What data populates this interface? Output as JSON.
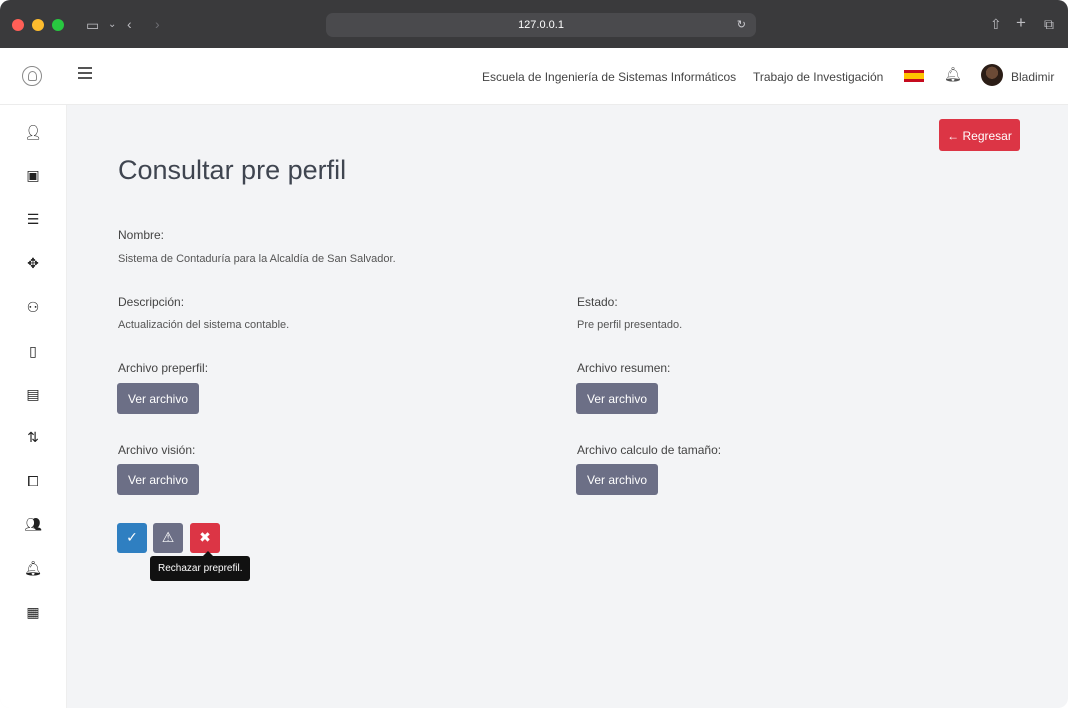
{
  "browser": {
    "url": "127.0.0.1",
    "traffic_colors": [
      "#ff5f57",
      "#febc2e",
      "#28c840"
    ]
  },
  "topbar": {
    "school": "Escuela de Ingeniería de Sistemas Informáticos",
    "work": "Trabajo de Investigación",
    "user": "Bladimir"
  },
  "sidebar": {
    "icons": [
      "users-list-icon",
      "building-icon",
      "layers-icon",
      "move-icon",
      "group-icon",
      "file-icon",
      "file-text-icon",
      "git-pull-icon",
      "code-window-icon",
      "users-list-icon-2",
      "bell-icon",
      "calendar-icon"
    ]
  },
  "page": {
    "back_label": "← Regresar",
    "title": "Consultar pre perfil",
    "name_label": "Nombre:",
    "name_value": "Sistema de Contaduría para la Alcaldía de San Salvador.",
    "description_label": "Descripción:",
    "description_value": "Actualización del sistema contable.",
    "state_label": "Estado:",
    "state_value": "Pre perfil presentado.",
    "file_preprofile_label": "Archivo preperfil:",
    "file_summary_label": "Archivo resumen:",
    "file_vision_label": "Archivo visión:",
    "file_size_label": "Archivo calculo de tamaño:",
    "view_file_label": "Ver archivo"
  },
  "actions": {
    "approve_icon": "✓",
    "observe_icon": "⚠",
    "reject_icon": "✖",
    "tooltip": "Rechazar preprefil.",
    "colors": {
      "approve": "#2f7fc1",
      "observe": "#6c6f86",
      "reject": "#dc3545"
    }
  }
}
